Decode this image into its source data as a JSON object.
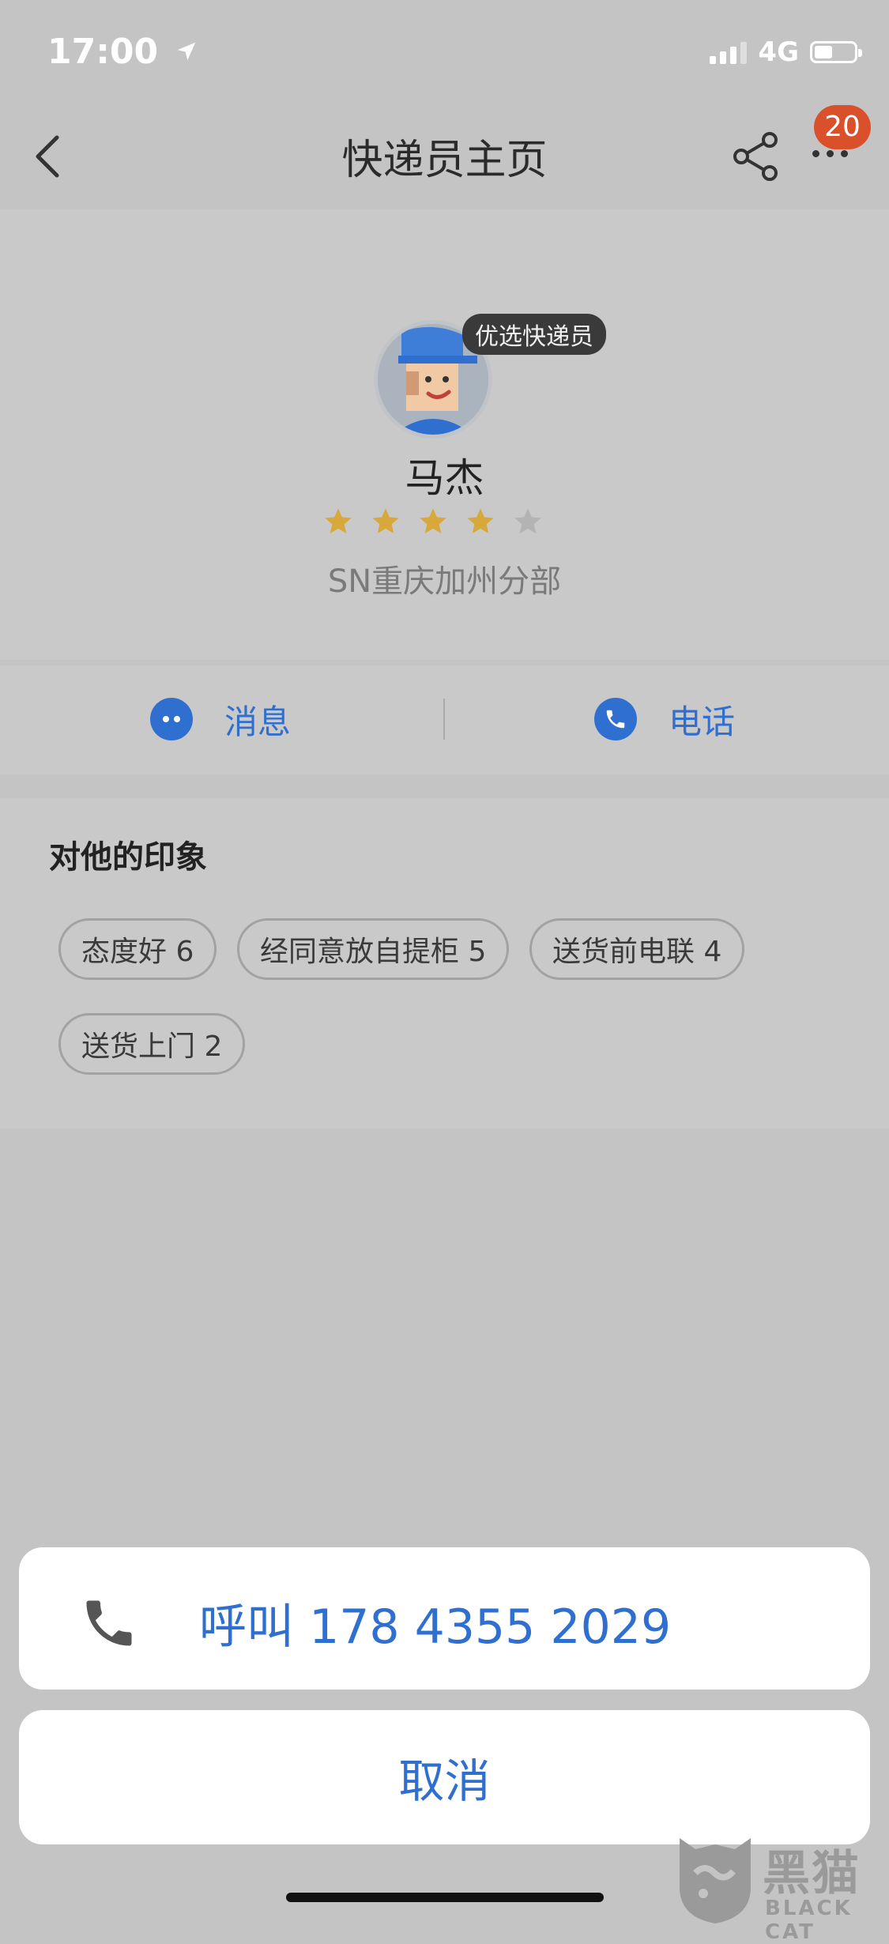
{
  "status_bar": {
    "time": "17:00",
    "network": "4G"
  },
  "nav": {
    "title": "快递员主页",
    "badge_count": "20"
  },
  "courier": {
    "preferred_tag": "优选快递员",
    "name": "马杰",
    "rating": {
      "value": 4,
      "max": 5
    },
    "branch": "SN重庆加州分部"
  },
  "actions": {
    "message_label": "消息",
    "phone_label": "电话"
  },
  "impressions": {
    "title": "对他的印象",
    "tags": [
      {
        "text": "态度好 6"
      },
      {
        "text": "经同意放自提柜 5"
      },
      {
        "text": "送货前电联 4"
      },
      {
        "text": "送货上门 2"
      }
    ]
  },
  "action_sheet": {
    "call_text": "呼叫 178 4355 2029",
    "cancel_label": "取消"
  },
  "watermark": {
    "cn": "黑猫",
    "en": "BLACK CAT"
  },
  "colors": {
    "accent": "#2f6fd0",
    "badge": "#d9502b",
    "star_filled": "#d8a93a",
    "star_empty": "#b3b3b3"
  }
}
